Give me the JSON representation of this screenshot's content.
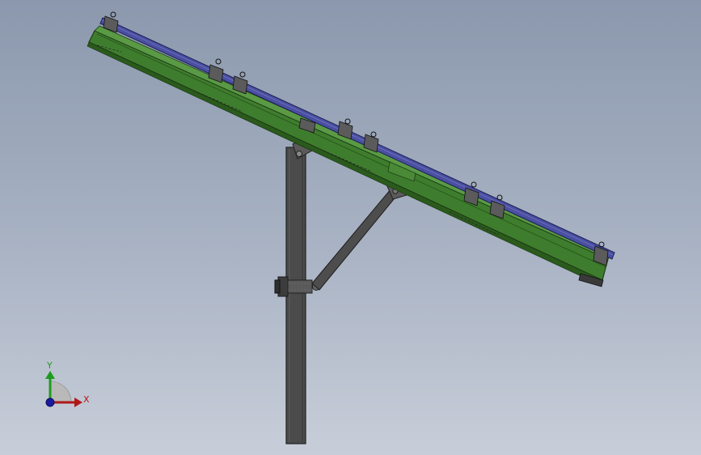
{
  "viewport": {
    "background_top": "#8b98ad",
    "background_bottom": "#c8ced9"
  },
  "model": {
    "post_color": "#4a4a4a",
    "brace_color": "#4a4a4a",
    "rail_color": "#3e7a2c",
    "rail_dark": "#2a5a1c",
    "panel_edge_color": "#4b4fa0",
    "clamp_count_groups": 6
  },
  "triad": {
    "x_label": "X",
    "y_label": "Y",
    "x_color": "#b01818",
    "y_color": "#1f9a1f",
    "z_color": "#1a1aa0"
  }
}
